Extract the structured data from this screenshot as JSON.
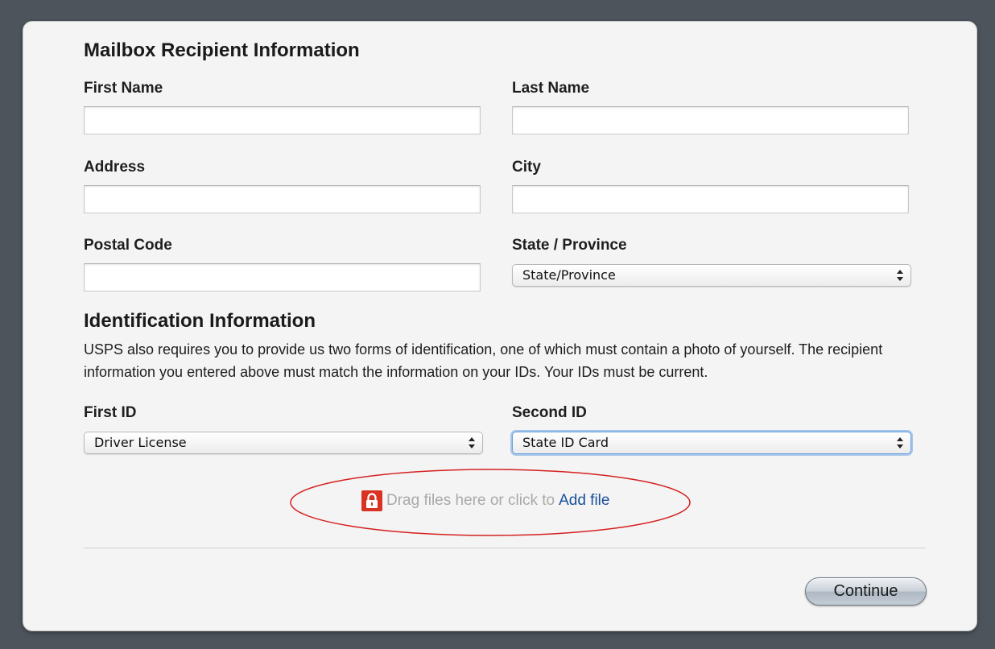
{
  "recipient_section": {
    "title": "Mailbox Recipient Information",
    "first_name": {
      "label": "First Name",
      "value": ""
    },
    "last_name": {
      "label": "Last Name",
      "value": ""
    },
    "address": {
      "label": "Address",
      "value": ""
    },
    "city": {
      "label": "City",
      "value": ""
    },
    "postal_code": {
      "label": "Postal Code",
      "value": ""
    },
    "state": {
      "label": "State / Province",
      "selected": "State/Province"
    }
  },
  "identification_section": {
    "title": "Identification Information",
    "description": "USPS also requires you to provide us two forms of identification, one of which must contain a photo of yourself. The recipient information you entered above must match the information on your IDs. Your IDs must be current.",
    "first_id": {
      "label": "First ID",
      "selected": "Driver License"
    },
    "second_id": {
      "label": "Second ID",
      "selected": "State ID Card"
    }
  },
  "upload": {
    "prompt": "Drag files here or click to",
    "link": "Add file",
    "icon": "lock-icon",
    "highlight_color": "#d62020"
  },
  "actions": {
    "continue_label": "Continue"
  },
  "colors": {
    "background": "#4e545c",
    "panel": "#f4f4f4",
    "lock_icon": "#d93323",
    "link": "#1a4f9a"
  }
}
